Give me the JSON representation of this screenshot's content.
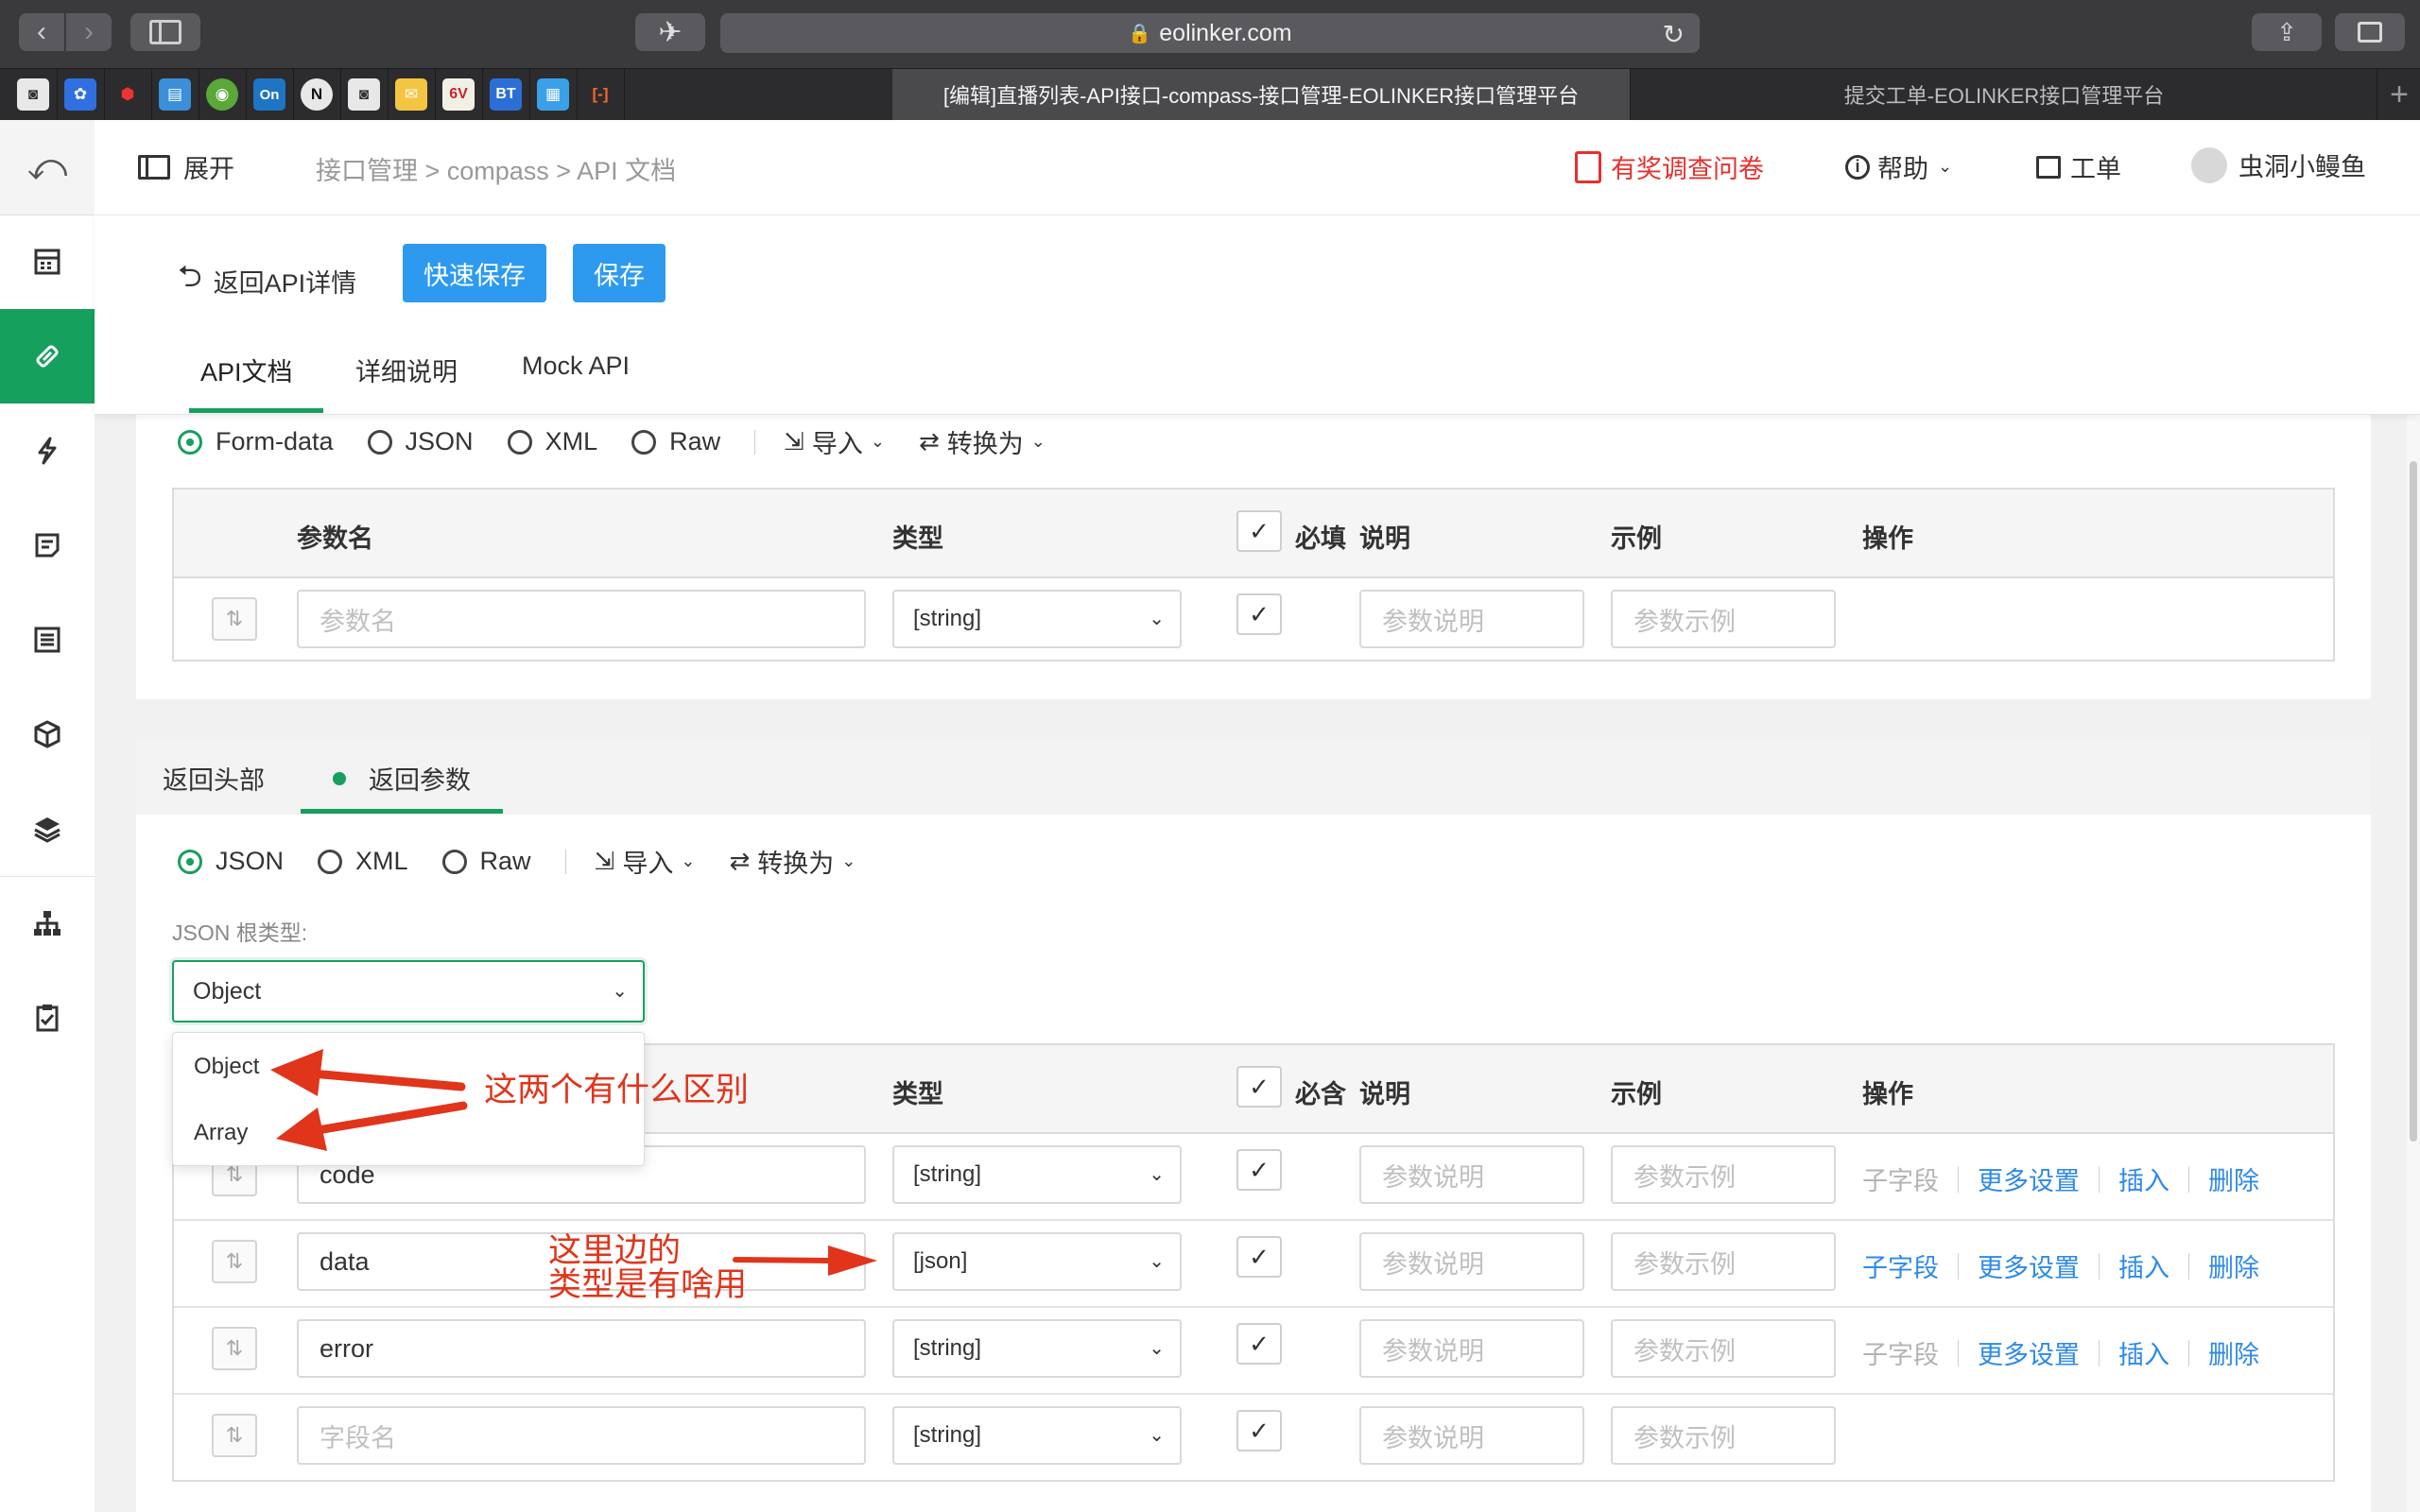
{
  "browser": {
    "url": "eolinker.com",
    "active_tab": "[编辑]直播列表-API接口-compass-接口管理-EOLINKER接口管理平台",
    "inactive_tab": "提交工单-EOLINKER接口管理平台",
    "favicons": [
      "On",
      "N",
      "6V",
      "BT"
    ]
  },
  "header": {
    "expand_label": "展开",
    "breadcrumb": "接口管理 > compass > API 文档",
    "survey_label": "有奖调查问卷",
    "help_label": "帮助",
    "ticket_label": "工单",
    "user_name": "虫洞小鳗鱼"
  },
  "subheader": {
    "back_label": "返回API详情",
    "quick_save_label": "快速保存",
    "save_label": "保存",
    "tabs": [
      "API文档",
      "详细说明",
      "Mock API"
    ]
  },
  "request": {
    "formats": [
      "Form-data",
      "JSON",
      "XML",
      "Raw"
    ],
    "selected_format": "Form-data",
    "import_label": "导入",
    "convert_label": "转换为",
    "columns": [
      "参数名",
      "类型",
      "必填",
      "说明",
      "示例",
      "操作"
    ],
    "row": {
      "name_placeholder": "参数名",
      "type": "[string]",
      "desc_placeholder": "参数说明",
      "example_placeholder": "参数示例"
    }
  },
  "response": {
    "tabs": [
      "返回头部",
      "返回参数"
    ],
    "active_tab": "返回参数",
    "formats": [
      "JSON",
      "XML",
      "Raw"
    ],
    "selected_format": "JSON",
    "import_label": "导入",
    "convert_label": "转换为",
    "root_type_label": "JSON 根类型:",
    "root_type_value": "Object",
    "root_type_options": [
      "Object",
      "Array"
    ],
    "columns": [
      "类型",
      "必含",
      "说明",
      "示例",
      "操作"
    ],
    "rows": [
      {
        "name": "code",
        "type": "[string]",
        "desc_placeholder": "参数说明",
        "example_placeholder": "参数示例",
        "subfield": "子字段",
        "subfield_enabled": false
      },
      {
        "name": "data",
        "type": "[json]",
        "desc_placeholder": "参数说明",
        "example_placeholder": "参数示例",
        "subfield": "子字段",
        "subfield_enabled": true
      },
      {
        "name": "error",
        "type": "[string]",
        "desc_placeholder": "参数说明",
        "example_placeholder": "参数示例",
        "subfield": "子字段",
        "subfield_enabled": false
      }
    ],
    "new_row": {
      "name_placeholder": "字段名",
      "type": "[string]",
      "desc_placeholder": "参数说明",
      "example_placeholder": "参数示例"
    },
    "action_labels": {
      "more": "更多设置",
      "insert": "插入",
      "delete": "删除"
    }
  },
  "annotations": {
    "note1": "这两个有什么区别",
    "note2_line1": "这里边的",
    "note2_line2": "类型是有啥用"
  },
  "colors": {
    "accent_green": "#16a05d",
    "button_blue": "#2d9af0",
    "link_blue": "#2d8ae8",
    "survey_red": "#e5302e",
    "annotation_red": "#e0351b"
  }
}
